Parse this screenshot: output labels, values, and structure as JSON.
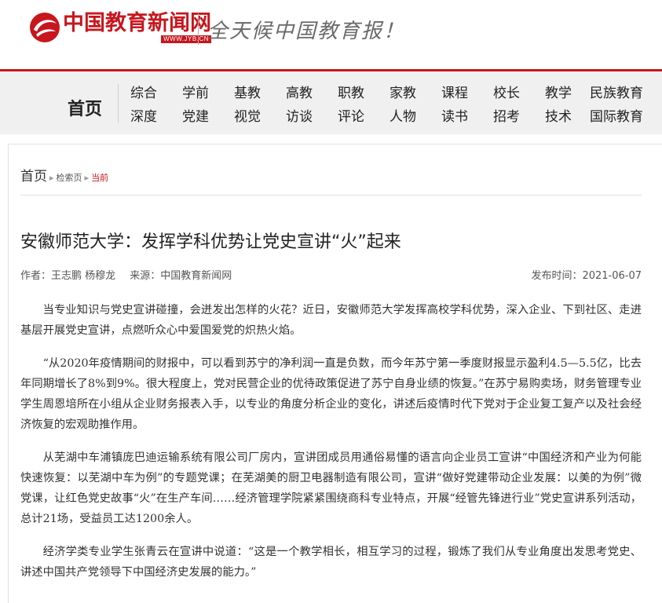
{
  "header": {
    "logo_name": "中国教育新闻网",
    "logo_url": "WWW.JYB.CN",
    "slogan": "全天候中国教育报！",
    "brand_color": "#c7161d"
  },
  "nav": {
    "home": "首页",
    "row1": [
      "综合",
      "学前",
      "基教",
      "高教",
      "职教",
      "家教",
      "课程",
      "校长",
      "教学",
      "民族教育"
    ],
    "row2": [
      "深度",
      "党建",
      "视觉",
      "访谈",
      "评论",
      "人物",
      "读书",
      "招考",
      "技术",
      "国际教育"
    ]
  },
  "breadcrumb": {
    "home": "首页",
    "search": "检索页",
    "current": "当前"
  },
  "article": {
    "title": "安徽师范大学：发挥学科优势让党史宣讲“火”起来",
    "authors_label": "作者：王志鹏 杨穆龙",
    "source_label": "来源：中国教育新闻网",
    "date_label": "发布时间：2021-06-07",
    "paragraphs": [
      "当专业知识与党史宣讲碰撞，会迸发出怎样的火花？近日，安徽师范大学发挥高校学科优势，深入企业、下到社区、走进基层开展党史宣讲，点燃听众心中爱国爱党的炽热火焰。",
      "“从2020年疫情期间的财报中，可以看到苏宁的净利润一直是负数，而今年苏宁第一季度财报显示盈利4.5—5.5亿，比去年同期增长了8%到9%。很大程度上，党对民营企业的优待政策促进了苏宁自身业绩的恢复。”在苏宁易购卖场，财务管理专业学生周恩培所在小组从企业财务报表入手，以专业的角度分析企业的变化，讲述后疫情时代下党对于企业复工复产以及社会经济恢复的宏观助推作用。",
      "从芜湖中车浦镇庞巴迪运输系统有限公司厂房内，宣讲团成员用通俗易懂的语言向企业员工宣讲“中国经济和产业为何能快速恢复：以芜湖中车为例”的专题党课；在芜湖美的厨卫电器制造有限公司，宣讲“做好党建带动企业发展：以美的为例”微党课，让红色党史故事“火”在生产车间……经济管理学院紧紧围绕商科专业特点，开展“经管先锋进行业”党史宣讲系列活动，总计21场，受益员工达1200余人。",
      "经济学类专业学生张青云在宣讲中说道：“这是一个教学相长，相互学习的过程，锻炼了我们从专业角度出发思考党史、讲述中国共产党领导下中国经济史发展的能力。”"
    ]
  }
}
